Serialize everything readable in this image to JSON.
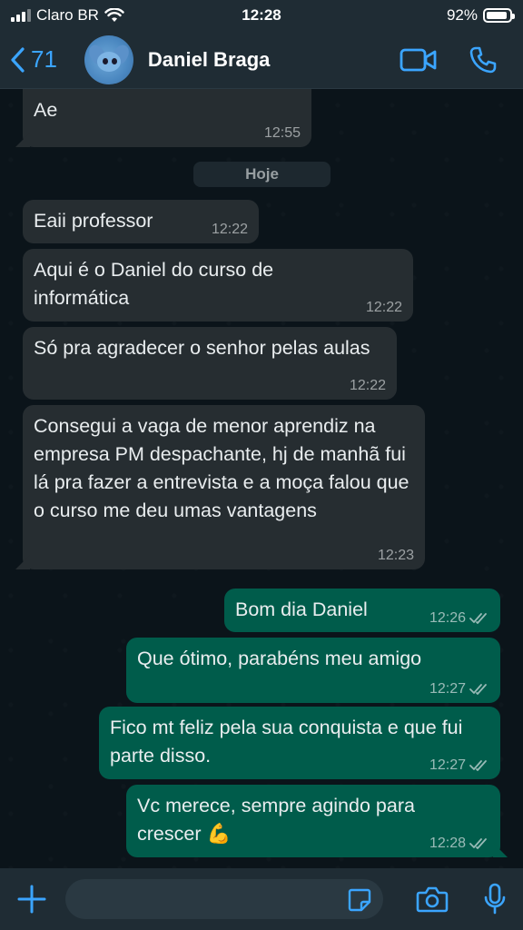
{
  "status_bar": {
    "carrier": "Claro BR",
    "time": "12:28",
    "battery": "92%",
    "battery_level": 0.92
  },
  "header": {
    "back_count": "71",
    "contact_name": "Daniel Braga",
    "icons": [
      "back-chevron-icon",
      "video-call-icon",
      "phone-icon"
    ]
  },
  "chat": {
    "date_separator": "Hoje",
    "messages": [
      {
        "dir": "in",
        "text": "Ae",
        "time": "12:55"
      },
      {
        "dir": "in",
        "text": "Eaii professor",
        "time": "12:22"
      },
      {
        "dir": "in",
        "text": "Aqui é o Daniel do curso de informática",
        "time": "12:22"
      },
      {
        "dir": "in",
        "text": "Só pra agradecer o senhor pelas aulas",
        "time": "12:22"
      },
      {
        "dir": "in",
        "text": "Consegui a vaga de menor aprendiz na empresa PM despachante, hj de manhã fui lá pra fazer a entrevista e a moça falou que o curso me deu umas vantagens",
        "time": "12:23"
      },
      {
        "dir": "out",
        "text": "Bom dia Daniel",
        "time": "12:26"
      },
      {
        "dir": "out",
        "text": "Que ótimo, parabéns meu amigo",
        "time": "12:27"
      },
      {
        "dir": "out",
        "text": "Fico mt feliz pela sua conquista e que fui parte disso.",
        "time": "12:27"
      },
      {
        "dir": "out",
        "text": "Vc merece, sempre agindo para crescer 💪",
        "time": "12:28"
      }
    ]
  },
  "input": {
    "placeholder": ""
  },
  "colors": {
    "incoming_bubble": "#262d31",
    "outgoing_bubble": "#005c4b",
    "accent": "#3ba5ff",
    "background": "#0b141a"
  }
}
